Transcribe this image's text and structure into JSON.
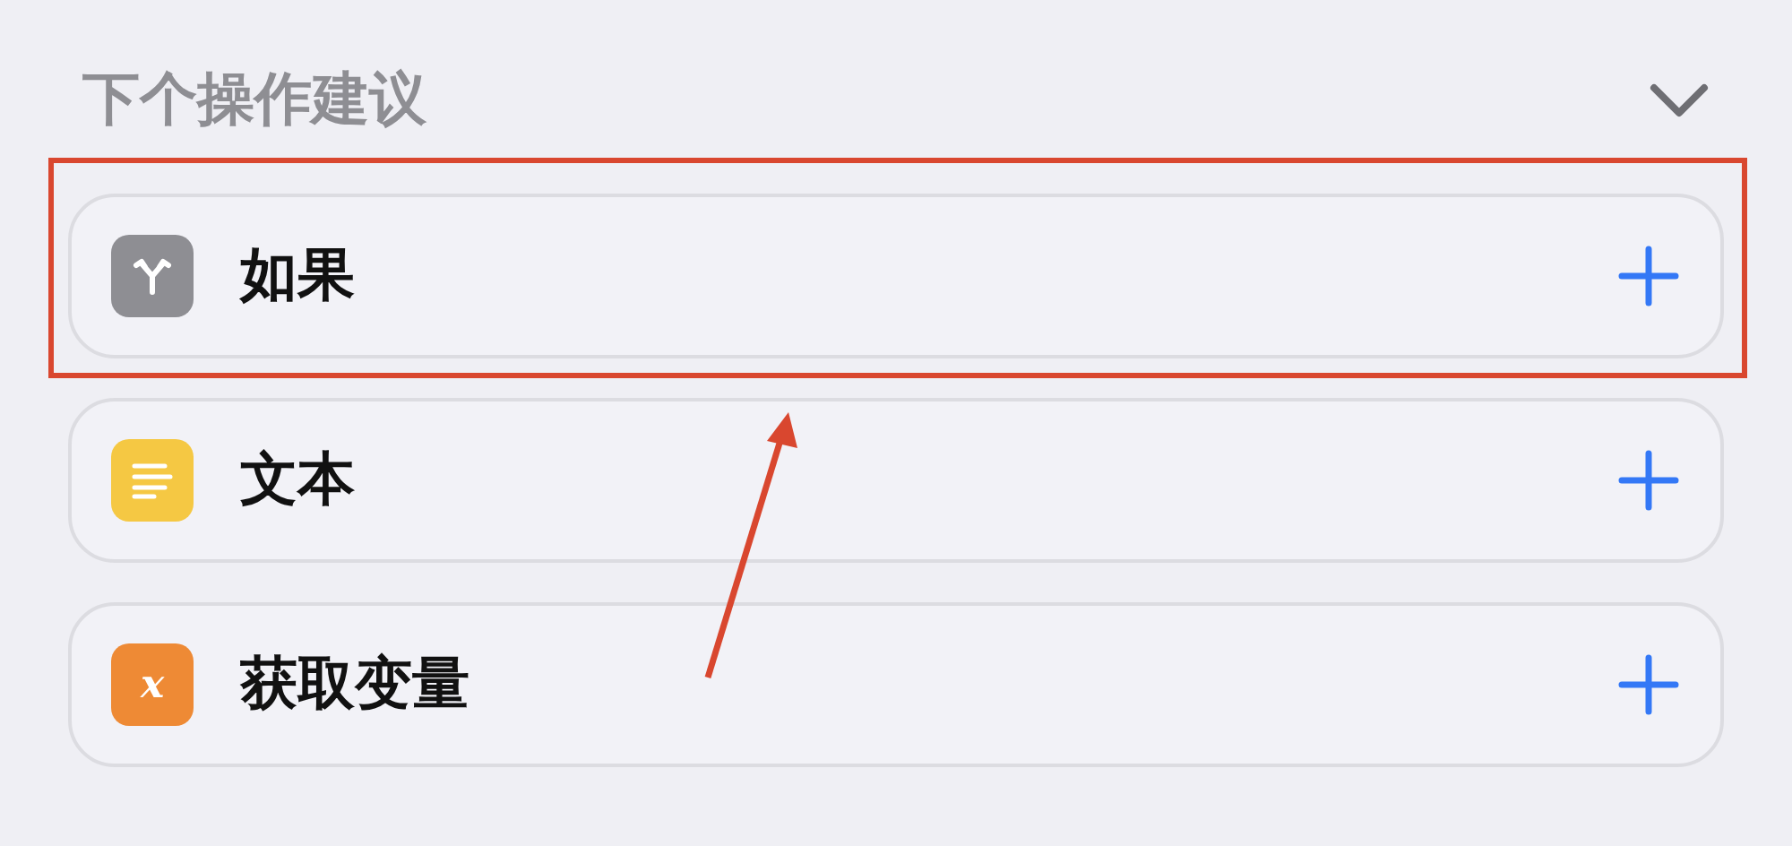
{
  "section": {
    "title": "下个操作建议",
    "expanded": true
  },
  "actions": [
    {
      "label": "如果",
      "kind": "branch",
      "color": "#8e8e93",
      "highlighted": true
    },
    {
      "label": "文本",
      "kind": "text",
      "color": "#f5c843",
      "highlighted": false
    },
    {
      "label": "获取变量",
      "kind": "variable",
      "color": "#ee8a35",
      "glyph": "x",
      "highlighted": false
    }
  ]
}
